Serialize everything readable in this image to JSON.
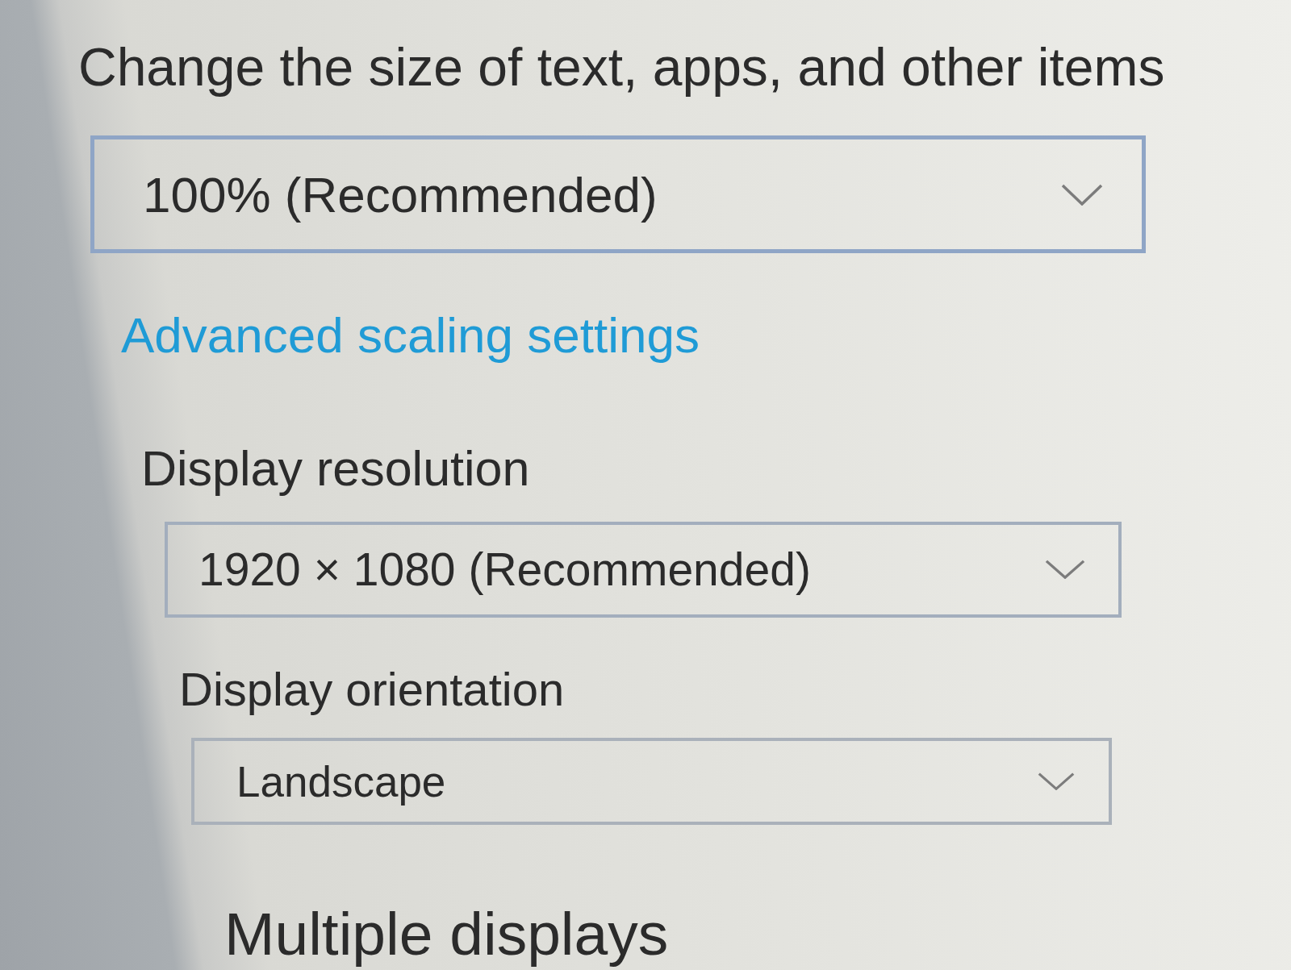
{
  "scaling": {
    "heading": "Change the size of text, apps, and other items",
    "dropdown": {
      "value": "100% (Recommended)"
    },
    "link": "Advanced scaling settings"
  },
  "resolution": {
    "label": "Display resolution",
    "dropdown": {
      "value": "1920 × 1080 (Recommended)"
    }
  },
  "orientation": {
    "label": "Display orientation",
    "dropdown": {
      "value": "Landscape"
    }
  },
  "multiple_displays": {
    "heading": "Multiple displays"
  }
}
